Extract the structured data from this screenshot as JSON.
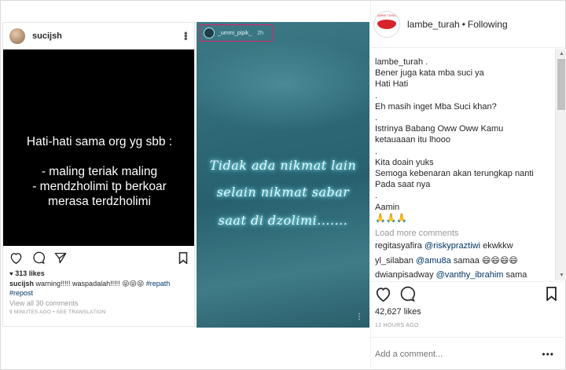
{
  "post1": {
    "username": "sucijsh",
    "image_line1": "Hati-hati sama org yg sbb :",
    "image_lines": [
      "- maling teriak maling",
      "- mendzholimi tp berkoar",
      "merasa terdzholimi"
    ],
    "likes": "313 likes",
    "caption_user": "sucijsh",
    "caption_text": "warning!!!!! waspadalah!!!!! 😜😜😜",
    "caption_tag1": "#repath",
    "caption_tag2": "#repost",
    "view_comments": "View all 30 comments",
    "time": "9 MINUTES AGO",
    "see_translation": "SEE TRANSLATION",
    "icons": [
      "heart-icon",
      "comment-icon",
      "share-icon",
      "bookmark-icon"
    ]
  },
  "story": {
    "username": "_ummi_pipik_",
    "time": "2h",
    "lines": [
      "Tidak ada nikmat lain",
      "selain nikmat sabar",
      "saat di dzolimi......."
    ]
  },
  "panel": {
    "username": "lambe_turah",
    "separator": "•",
    "following": "Following",
    "avatar_tag": "LAMBE TURAH",
    "caption_lines": [
      "lambe_turah .",
      "Bener juga kata mba suci ya",
      "Hati Hati",
      ".",
      "Eh masih inget Mba Suci khan?",
      ".",
      "Istrinya Babang Oww Oww Kamu",
      "ketauaaan itu lhooo",
      ".",
      "Kita doain yuks",
      "Semoga kebenaran akan terungkap nanti",
      "Pada saat nya",
      ".",
      "Aamin",
      "🙏🙏🙏"
    ],
    "load_more": "Load more comments",
    "comments": [
      {
        "user": "regitasyafira",
        "mention": "@riskypraztiwi",
        "text": "ekwkkw"
      },
      {
        "user": "yl_silaban",
        "mention": "@amu8a",
        "text": "samaa 😄😄😄😄"
      },
      {
        "user": "dwianpisadway",
        "mention": "@vanthy_ibrahim",
        "text": "sama"
      }
    ],
    "likes": "42,627 likes",
    "time": "12 HOURS AGO",
    "add_comment_placeholder": "Add a comment...",
    "more": "•••"
  },
  "colors": {
    "link": "#003569",
    "muted": "#999999",
    "highlight_border": "#d8246a",
    "lips": "#d8232a"
  }
}
